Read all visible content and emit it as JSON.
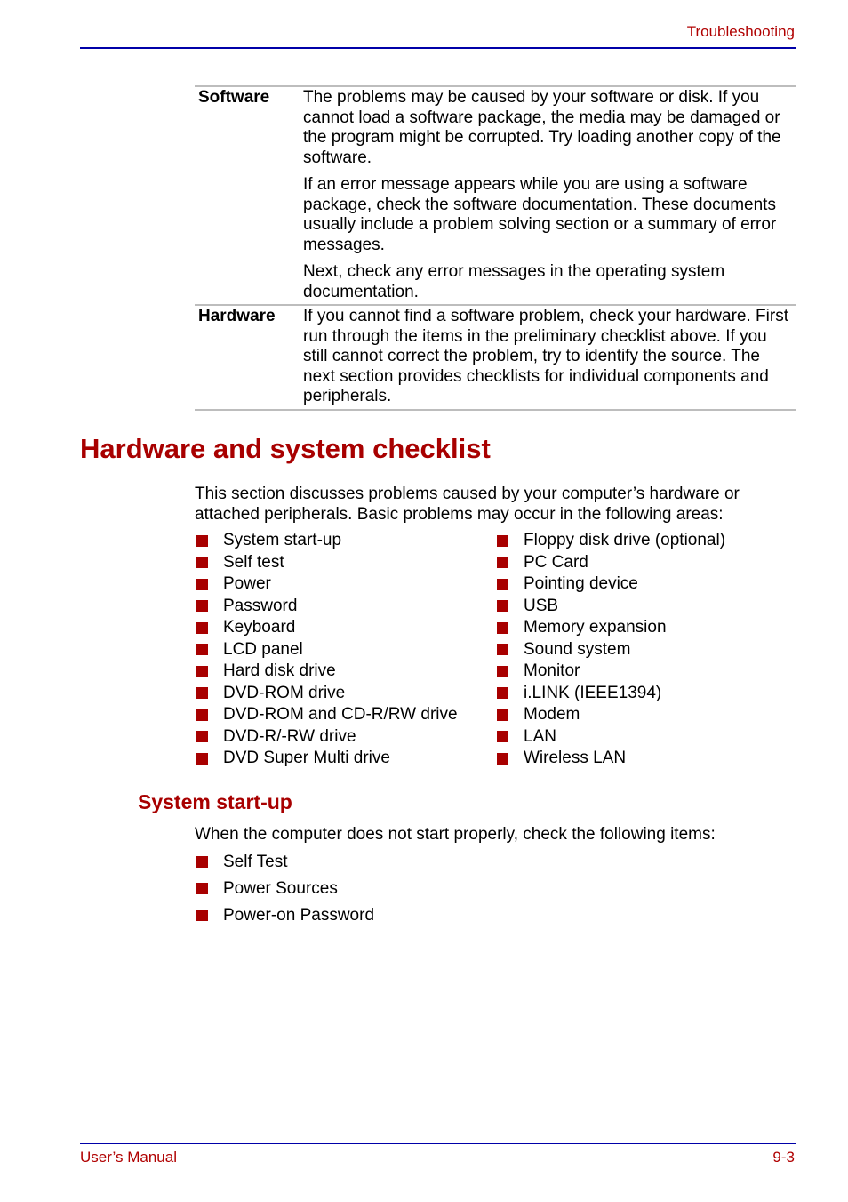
{
  "header": {
    "section_title": "Troubleshooting"
  },
  "definitions": [
    {
      "term": "Software",
      "paragraphs": [
        "The problems may be caused by your software or disk. If you cannot load a software package, the media may be damaged or the program might be corrupted. Try loading another copy of the software.",
        "If an error message appears while you are using a software package, check the software documentation. These documents usually include a problem solving section or a summary of error messages.",
        "Next, check any error messages in the operating system documentation."
      ]
    },
    {
      "term": "Hardware",
      "paragraphs": [
        "If you cannot find a software problem, check your hardware. First run through the items in the preliminary checklist above. If you still cannot correct the problem, try to identify the source. The next section provides checklists for individual components and peripherals."
      ]
    }
  ],
  "checklist_section": {
    "heading": "Hardware and system checklist",
    "intro": "This section discusses problems caused by your computer’s hardware or attached peripherals. Basic problems may occur in the following areas:",
    "left_items": [
      "System start-up",
      "Self test",
      "Power",
      "Password",
      "Keyboard",
      "LCD panel",
      "Hard disk drive",
      "DVD-ROM drive",
      "DVD-ROM and CD-R/RW drive",
      "DVD-R/-RW drive",
      "DVD Super Multi drive"
    ],
    "right_items": [
      "Floppy disk drive (optional)",
      "PC Card",
      "Pointing device",
      "USB",
      "Memory expansion",
      "Sound system",
      "Monitor",
      "i.LINK (IEEE1394)",
      "Modem",
      "LAN",
      "Wireless LAN"
    ]
  },
  "startup_section": {
    "heading": "System start-up",
    "intro": "When the computer does not start properly, check the following items:",
    "items": [
      "Self Test",
      "Power Sources",
      "Power-on Password"
    ]
  },
  "footer": {
    "left": "User’s Manual",
    "page_number": "9-3"
  },
  "colors": {
    "accent_red": "#a80000",
    "rule_blue": "#0000a8",
    "table_rule_gray": "#bdbdbd"
  }
}
